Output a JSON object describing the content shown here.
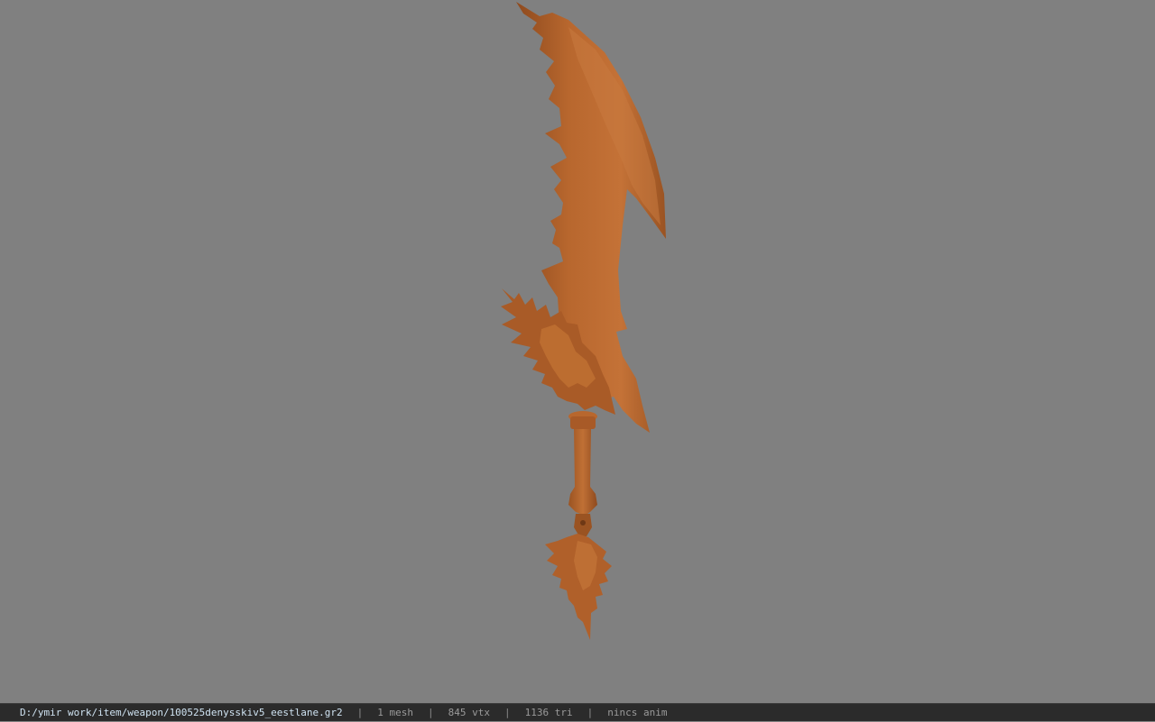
{
  "viewer": {
    "background_color": "#808080",
    "model_color": "#b8672e"
  },
  "status": {
    "file_path": "D:/ymir work/item/weapon/100525denysskiv5_eestlane.gr2",
    "separator": "|",
    "mesh": "1 mesh",
    "vertices": "845 vtx",
    "triangles": "1136 tri",
    "animation": "nincs anim"
  }
}
